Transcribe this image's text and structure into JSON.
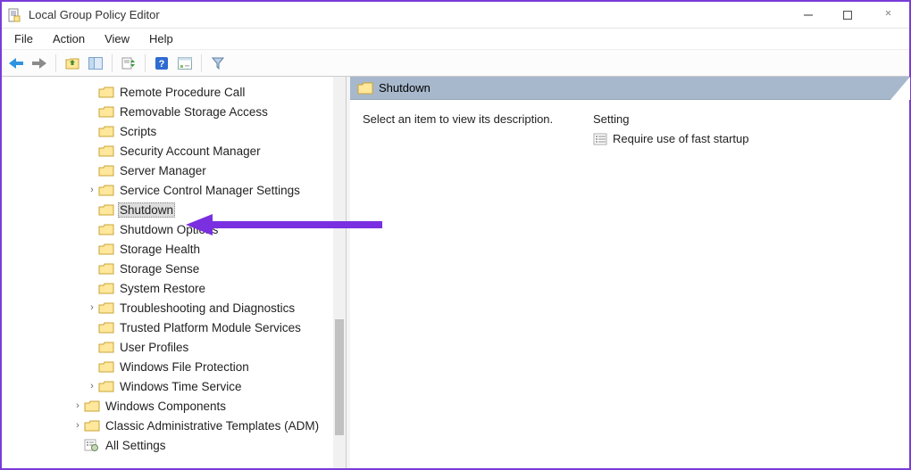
{
  "window": {
    "title": "Local Group Policy Editor"
  },
  "menubar": [
    "File",
    "Action",
    "View",
    "Help"
  ],
  "tree": {
    "items": [
      {
        "label": "Remote Procedure Call",
        "indent": 3,
        "exp": ""
      },
      {
        "label": "Removable Storage Access",
        "indent": 3,
        "exp": ""
      },
      {
        "label": "Scripts",
        "indent": 3,
        "exp": ""
      },
      {
        "label": "Security Account Manager",
        "indent": 3,
        "exp": ""
      },
      {
        "label": "Server Manager",
        "indent": 3,
        "exp": ""
      },
      {
        "label": "Service Control Manager Settings",
        "indent": 3,
        "exp": ">"
      },
      {
        "label": "Shutdown",
        "indent": 3,
        "exp": "",
        "selected": true
      },
      {
        "label": "Shutdown Options",
        "indent": 3,
        "exp": ""
      },
      {
        "label": "Storage Health",
        "indent": 3,
        "exp": ""
      },
      {
        "label": "Storage Sense",
        "indent": 3,
        "exp": ""
      },
      {
        "label": "System Restore",
        "indent": 3,
        "exp": ""
      },
      {
        "label": "Troubleshooting and Diagnostics",
        "indent": 3,
        "exp": ">"
      },
      {
        "label": "Trusted Platform Module Services",
        "indent": 3,
        "exp": ""
      },
      {
        "label": "User Profiles",
        "indent": 3,
        "exp": ""
      },
      {
        "label": "Windows File Protection",
        "indent": 3,
        "exp": ""
      },
      {
        "label": "Windows Time Service",
        "indent": 3,
        "exp": ">"
      },
      {
        "label": "Windows Components",
        "indent": 2,
        "exp": ">"
      },
      {
        "label": "Classic Administrative Templates (ADM)",
        "indent": 2,
        "exp": ">"
      },
      {
        "label": "All Settings",
        "indent": 2,
        "exp": "",
        "icon": "settings"
      }
    ]
  },
  "detail": {
    "header": "Shutdown",
    "description": "Select an item to view its description.",
    "columnHeader": "Setting",
    "settings": [
      {
        "label": "Require use of fast startup"
      }
    ]
  }
}
